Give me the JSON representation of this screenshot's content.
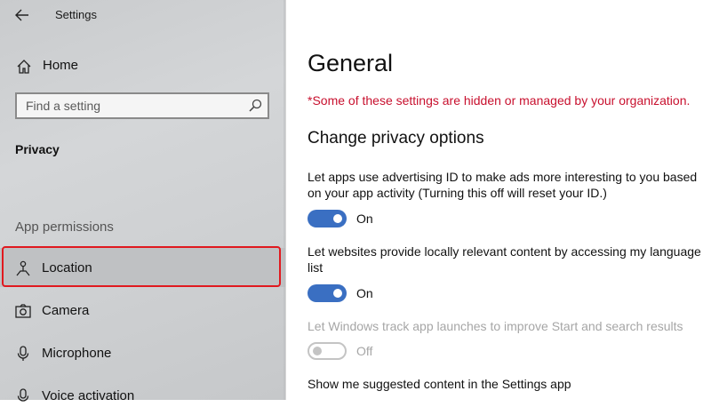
{
  "window": {
    "title": "Settings"
  },
  "sidebar": {
    "home_label": "Home",
    "search": {
      "placeholder": "Find a setting"
    },
    "section_title": "Privacy",
    "group_title": "App permissions",
    "items": [
      {
        "label": "Location",
        "icon": "location-icon",
        "selected": true
      },
      {
        "label": "Camera",
        "icon": "camera-icon"
      },
      {
        "label": "Microphone",
        "icon": "microphone-icon"
      },
      {
        "label": "Voice activation",
        "icon": "voice-activation-icon"
      }
    ]
  },
  "main": {
    "title": "General",
    "org_notice": "*Some of these settings are hidden or managed by your organization.",
    "subtitle": "Change privacy options",
    "settings": [
      {
        "description": "Let apps use advertising ID to make ads more interesting to you based on your app activity (Turning this off will reset your ID.)",
        "state": "On",
        "enabled": true
      },
      {
        "description": "Let websites provide locally relevant content by accessing my language list",
        "state": "On",
        "enabled": true
      },
      {
        "description": "Let Windows track app launches to improve Start and search results",
        "state": "Off",
        "enabled": false
      },
      {
        "description": "Show me suggested content in the Settings app"
      }
    ]
  },
  "colors": {
    "accent": "#3a6fc2",
    "notice": "#c8102e",
    "highlight": "#e0191f"
  }
}
